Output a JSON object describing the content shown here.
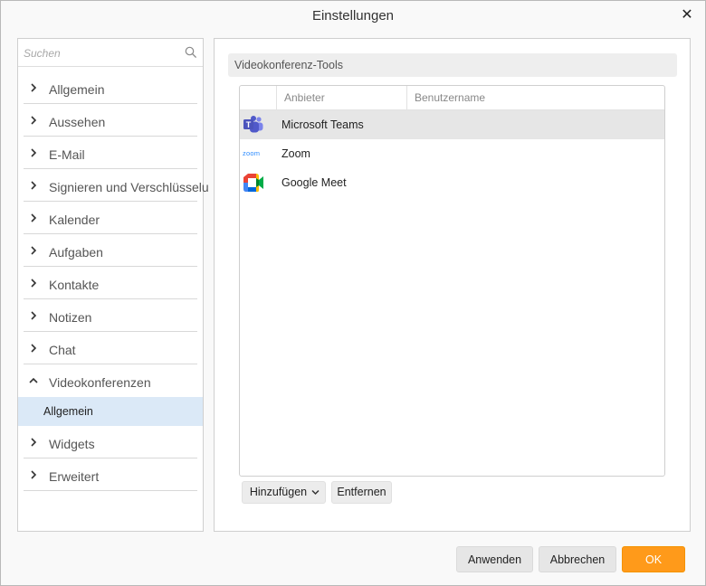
{
  "window": {
    "title": "Einstellungen",
    "close_glyph": "✕"
  },
  "sidebar": {
    "search_placeholder": "Suchen",
    "items": [
      {
        "label": "Allgemein"
      },
      {
        "label": "Aussehen"
      },
      {
        "label": "E-Mail"
      },
      {
        "label": "Signieren und Verschlüsselu"
      },
      {
        "label": "Kalender"
      },
      {
        "label": "Aufgaben"
      },
      {
        "label": "Kontakte"
      },
      {
        "label": "Notizen"
      },
      {
        "label": "Chat"
      },
      {
        "label": "Videokonferenzen",
        "expanded": true
      },
      {
        "label": "Widgets"
      },
      {
        "label": "Erweitert"
      }
    ],
    "sub_items": [
      {
        "label": "Allgemein",
        "selected": true
      }
    ]
  },
  "main": {
    "section_title": "Videokonferenz-Tools",
    "table": {
      "columns": [
        "Anbieter",
        "Benutzername"
      ],
      "rows": [
        {
          "name": "Microsoft Teams",
          "logo": "microsoft-teams-logo",
          "selected": true
        },
        {
          "name": "Zoom",
          "logo": "zoom-logo"
        },
        {
          "name": "Google Meet",
          "logo": "google-meet-logo"
        }
      ]
    },
    "add_button": "Hinzufügen",
    "remove_button": "Entfernen"
  },
  "footer": {
    "apply": "Anwenden",
    "cancel": "Abbrechen",
    "ok": "OK"
  },
  "colors": {
    "accent_ok": "#ff9a1a",
    "selection": "#dbe9f7",
    "row_selected": "#e6e6e6"
  }
}
